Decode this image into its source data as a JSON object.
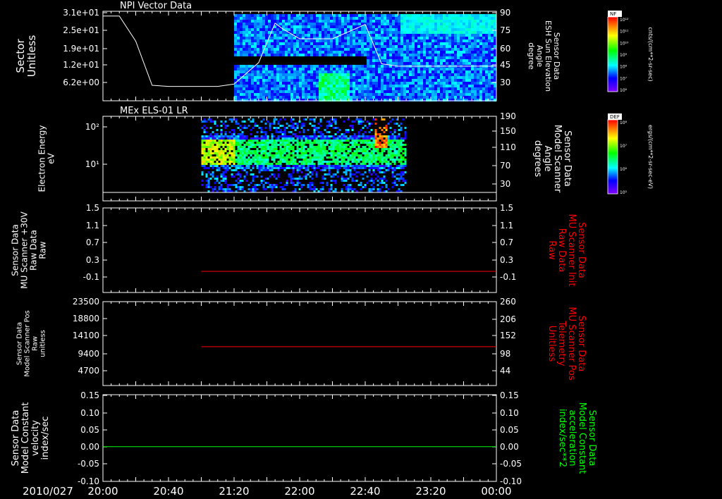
{
  "time_axis": {
    "date": "2010/027",
    "start": "20:00",
    "end": "00:00",
    "ticks": [
      "20:00",
      "20:40",
      "21:20",
      "22:00",
      "22:40",
      "23:20",
      "00:00"
    ]
  },
  "colors": {
    "white": "#ffffff",
    "red": "#ff0000",
    "green": "#00ff00",
    "background": "#000000"
  },
  "chart_data": [
    {
      "type": "heatmap",
      "title": "NPI Vector Data",
      "ylabel_left": [
        "Sector",
        "Unitless"
      ],
      "ylabel_right": [
        "Sensor Data",
        "ESH Sun Elevation",
        "Angle",
        "degree"
      ],
      "yticks_left": [
        "3.1e+01",
        "2.5e+01",
        "1.9e+01",
        "1.2e+01",
        "6.2e+00"
      ],
      "yticks_right": [
        "90",
        "75",
        "60",
        "45",
        "30"
      ],
      "ylim_right": [
        15,
        90
      ],
      "colorbar": {
        "label": "NF",
        "unit": "cnts/(cm**2-sr-sec)",
        "ticks": [
          "10¹²",
          "10¹¹",
          "10¹⁰",
          "10⁹",
          "10⁸",
          "10⁷",
          "10⁶"
        ]
      },
      "line_series": {
        "color": "white",
        "x": [
          "20:00",
          "20:10",
          "20:20",
          "20:30",
          "20:40",
          "21:00",
          "21:10",
          "21:20",
          "21:35",
          "21:45",
          "21:50",
          "22:00",
          "22:10",
          "22:20",
          "22:30",
          "22:40",
          "22:50",
          "23:00",
          "23:30",
          "00:00"
        ],
        "y": [
          86,
          86,
          65,
          28,
          27,
          27,
          27,
          29,
          47,
          80,
          75,
          67,
          67,
          67,
          73,
          79,
          46,
          44,
          44,
          44
        ]
      }
    },
    {
      "type": "heatmap",
      "title": "MEx ELS-01 LR",
      "ylabel_left": [
        "Electron Energy",
        "eV"
      ],
      "ylabel_right": [
        "Sensor Data",
        "Model Scanner",
        "Angle",
        "degrees"
      ],
      "yticks_left": [
        "10²",
        "10¹"
      ],
      "yticks_right": [
        "190",
        "150",
        "110",
        "70",
        "30"
      ],
      "ylim_right": [
        0,
        190
      ],
      "colorbar": {
        "label": "DEF",
        "unit": "ergs/(cm**2-sr-sec-eV)",
        "ticks": [
          "10⁸",
          "10⁷",
          "10⁶",
          "10⁵"
        ]
      },
      "line_series": {
        "color": "white",
        "x": [
          "20:00",
          "00:00"
        ],
        "y": [
          0,
          0
        ]
      }
    },
    {
      "type": "line",
      "ylabel_left": [
        "Sensor Data",
        "MU Scanner +30V",
        "Raw Data",
        "Raw"
      ],
      "ylabel_right": [
        "Sensor Data",
        "MU Scanner Init",
        "Raw Data",
        "Raw"
      ],
      "yticks_left": [
        "1.5",
        "1.1",
        "0.7",
        "0.3",
        "-0.1"
      ],
      "yticks_right": [
        "1.5",
        "1.1",
        "0.7",
        "0.3",
        "-0.1"
      ],
      "ylim": [
        -0.5,
        1.5
      ],
      "series": [
        {
          "color": "red",
          "x": [
            "21:00",
            "00:00"
          ],
          "y": [
            0.0,
            0.0
          ]
        }
      ]
    },
    {
      "type": "line",
      "ylabel_left": [
        "Sensor Data",
        "Model Scanner Pos",
        "Raw",
        "unitless"
      ],
      "ylabel_right": [
        "Sensor Data",
        "MU Scanner Pos",
        "Telemetry",
        "Unitless"
      ],
      "yticks_left": [
        "23500",
        "18800",
        "14100",
        "9400",
        "4700"
      ],
      "yticks_right": [
        "260",
        "206",
        "152",
        "98",
        "44"
      ],
      "ylim_right": [
        -10,
        260
      ],
      "series": [
        {
          "color": "red",
          "x": [
            "21:00",
            "00:00"
          ],
          "y": [
            115,
            115
          ]
        }
      ]
    },
    {
      "type": "line",
      "ylabel_left": [
        "Sensor Data",
        "Model Constant",
        "velocity",
        "index/sec"
      ],
      "ylabel_right": [
        "Sensor Data",
        "Model Constant",
        "acceleration",
        "index/sec**2"
      ],
      "yticks_left": [
        "0.15",
        "0.10",
        "0.05",
        "0.00",
        "-0.05",
        "-0.10"
      ],
      "yticks_right": [
        "0.15",
        "0.10",
        "0.05",
        "0.00",
        "-0.05",
        "-0.10"
      ],
      "ylim": [
        -0.1,
        0.15
      ],
      "series": [
        {
          "color": "green",
          "x": [
            "20:00",
            "00:00"
          ],
          "y": [
            0.0,
            0.0
          ]
        }
      ]
    }
  ]
}
